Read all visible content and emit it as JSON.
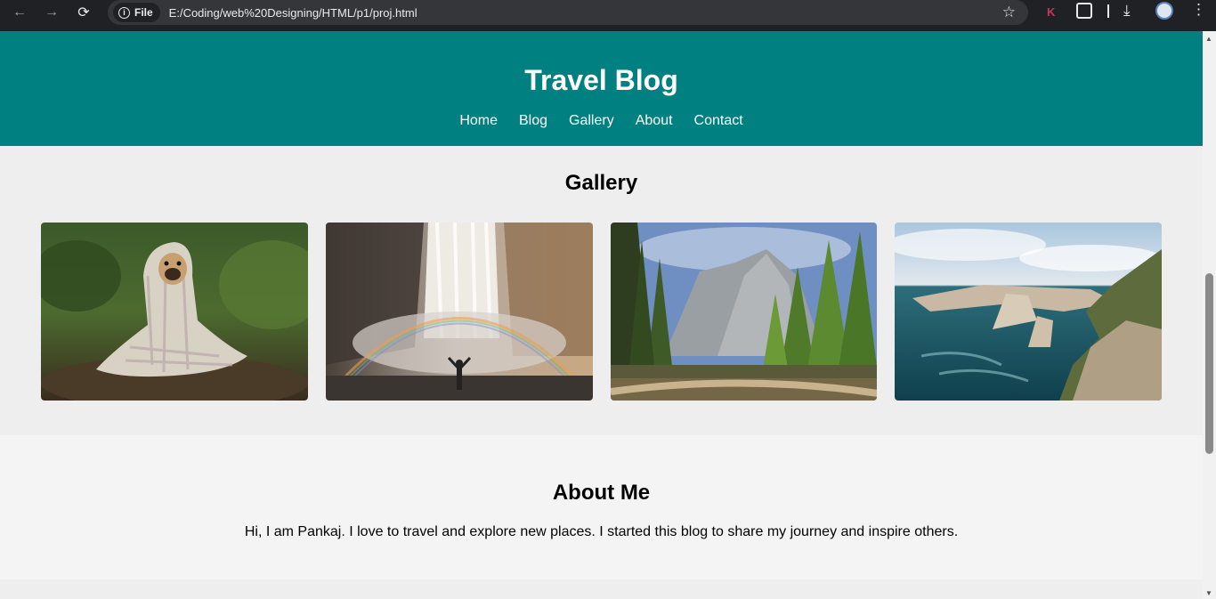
{
  "browser": {
    "file_chip": "File",
    "url": "E:/Coding/web%20Designing/HTML/p1/proj.html",
    "extension_letter": "K"
  },
  "header": {
    "title": "Travel Blog",
    "nav": [
      "Home",
      "Blog",
      "Gallery",
      "About",
      "Contact"
    ],
    "bg_color": "#008080"
  },
  "gallery": {
    "heading": "Gallery",
    "photos": [
      "pug-in-blanket-photo",
      "waterfall-rainbow-photo",
      "forest-valley-river-photo",
      "coastal-cliffs-sea-photo"
    ]
  },
  "about": {
    "heading": "About Me",
    "text": "Hi, I am Pankaj. I love to travel and explore new places. I started this blog to share my journey and inspire others."
  }
}
